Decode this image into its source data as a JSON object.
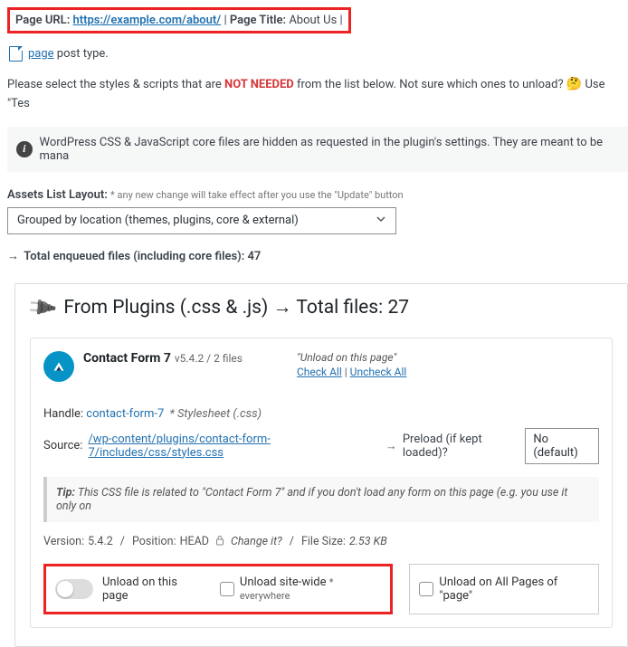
{
  "header": {
    "page_url_label": "Page URL:",
    "page_url": "https://example.com/about/",
    "page_title_label": "Page Title:",
    "page_title": "About Us"
  },
  "post_type": {
    "link": "page",
    "suffix": " post type."
  },
  "instructions": {
    "prefix": "Please select the styles & scripts that are ",
    "not_needed": "NOT NEEDED",
    "middle": " from the list below. Not sure which ones to unload? ",
    "emoji": "🤔",
    "suffix": " Use \"Tes"
  },
  "infobar": {
    "text": "WordPress CSS & JavaScript core files are hidden as requested in the plugin's settings. They are meant to be mana"
  },
  "layout": {
    "label": "Assets List Layout:",
    "note": " * any new change will take effect after you use the \"Update\" button",
    "selected": "Grouped by location (themes, plugins, core & external)"
  },
  "total_enqueued": {
    "arrow": "→",
    "label": "Total enqueued files (including core files): ",
    "count": "47"
  },
  "panel": {
    "title_prefix": "From Plugins (.css & .js) ",
    "title_arrow": "→",
    "title_suffix": " Total files: 27"
  },
  "plugin": {
    "name": "Contact Form 7",
    "meta": " v5.4.2 / 2 files",
    "unload_hint": "\"Unload on this page\"",
    "check_all": "Check All",
    "sep": " | ",
    "uncheck_all": "Uncheck All",
    "handle_label": "Handle: ",
    "handle_value": "contact-form-7",
    "handle_type": "* Stylesheet (.css)",
    "source_label": "Source: ",
    "source_value": "/wp-content/plugins/contact-form-7/includes/css/styles.css",
    "source_arrow": "→",
    "preload_label": " Preload (if kept loaded)?",
    "preload_value": "No (default)",
    "tip_label": "Tip:",
    "tip_text": " This CSS file is related to \"Contact Form 7\" and if you don't load any form on this page (e.g. you use it only on ",
    "version_label": "Version: ",
    "version": "5.4.2",
    "position_label": "Position: ",
    "position": "HEAD",
    "change_label": " Change it?",
    "filesize_label": "File Size: ",
    "filesize": "2.53 KB",
    "unload_page": "Unload on this page",
    "unload_sitewide": "Unload site-wide ",
    "unload_sitewide_sub": "* everywhere",
    "unload_all_pages": "Unload on All Pages of \"page\""
  }
}
